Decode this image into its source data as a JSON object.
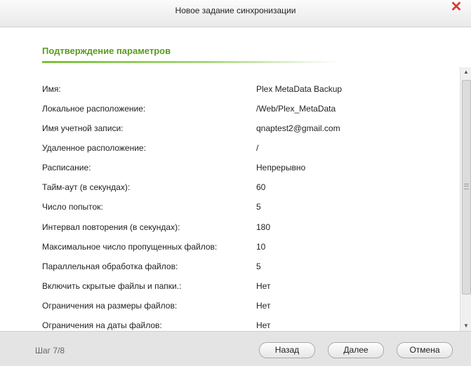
{
  "window": {
    "title": "Новое задание синхронизации",
    "close_glyph": "✕"
  },
  "section": {
    "title": "Подтверждение параметров"
  },
  "params": [
    {
      "label": "Имя:",
      "value": "Plex MetaData Backup"
    },
    {
      "label": "Локальное расположение:",
      "value": "/Web/Plex_MetaData"
    },
    {
      "label": "Имя учетной записи:",
      "value": "qnaptest2@gmail.com"
    },
    {
      "label": "Удаленное расположение:",
      "value": "/"
    },
    {
      "label": "Расписание:",
      "value": "Непрерывно"
    },
    {
      "label": "Тайм-аут (в секундах):",
      "value": "60"
    },
    {
      "label": "Число попыток:",
      "value": "5"
    },
    {
      "label": "Интервал повторения (в секундах):",
      "value": "180"
    },
    {
      "label": "Максимальное число пропущенных файлов:",
      "value": "10"
    },
    {
      "label": "Параллельная обработка файлов:",
      "value": "5"
    },
    {
      "label": "Включить скрытые файлы и папки.:",
      "value": "Нет"
    },
    {
      "label": "Ограничения на размеры файлов:",
      "value": "Нет"
    },
    {
      "label": "Ограничения на даты файлов:",
      "value": "Нет"
    }
  ],
  "footer": {
    "step": "Шаг 7/8",
    "back_label": "Назад",
    "next_label": "Далее",
    "cancel_label": "Отмена"
  },
  "colors": {
    "accent": "#5a9c1e",
    "close": "#d63b2f"
  },
  "icons": {
    "close": "close-icon",
    "scroll_up": "scroll-up-arrow-icon",
    "scroll_down": "scroll-down-arrow-icon"
  }
}
